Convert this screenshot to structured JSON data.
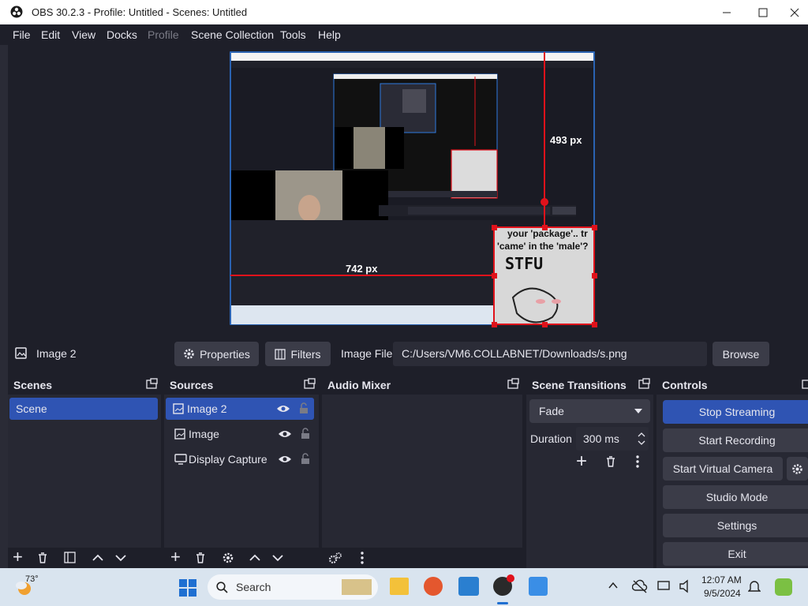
{
  "window": {
    "title": "OBS 30.2.3 - Profile: Untitled - Scenes: Untitled"
  },
  "menu": [
    "File",
    "Edit",
    "View",
    "Docks",
    "Profile",
    "Scene Collection",
    "Tools",
    "Help"
  ],
  "preview": {
    "height_label": "493 px",
    "width_label": "742 px",
    "meme_text_1": "your 'package'.. tr",
    "meme_text_2": "'came' in the 'male'?",
    "meme_text_3": "STFU"
  },
  "source_toolbar": {
    "selected_source": "Image 2",
    "properties_label": "Properties",
    "filters_label": "Filters",
    "image_file_label": "Image File",
    "image_file_path": "C:/Users/VM6.COLLABNET/Downloads/s.png",
    "browse_label": "Browse"
  },
  "scenes": {
    "title": "Scenes",
    "items": [
      "Scene"
    ]
  },
  "sources": {
    "title": "Sources",
    "items": [
      "Image 2",
      "Image",
      "Display Capture"
    ]
  },
  "audio_mixer": {
    "title": "Audio Mixer"
  },
  "scene_transitions": {
    "title": "Scene Transitions",
    "transition": "Fade",
    "duration_label": "Duration",
    "duration_value": "300 ms"
  },
  "controls": {
    "title": "Controls",
    "stop_streaming": "Stop Streaming",
    "start_recording": "Start Recording",
    "start_virtual_camera": "Start Virtual Camera",
    "studio_mode": "Studio Mode",
    "settings": "Settings",
    "exit": "Exit"
  },
  "taskbar": {
    "weather": "73°",
    "search_placeholder": "Search",
    "time": "12:07 AM",
    "date": "9/5/2024"
  },
  "colors": {
    "accent": "#2f54b3",
    "background": "#1e1f29",
    "panel": "#272833",
    "button": "#3b3c48",
    "selection_red": "#e0121b"
  }
}
